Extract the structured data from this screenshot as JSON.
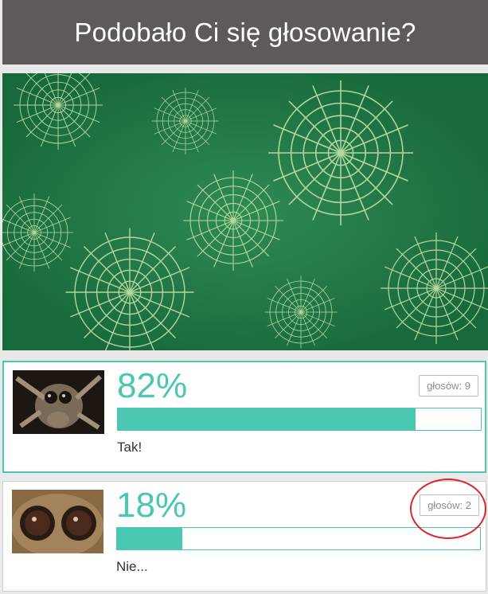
{
  "header": {
    "title": "Podobało Ci się głosowanie?"
  },
  "hero": {
    "icon": "spiderweb-image"
  },
  "options": [
    {
      "percent": "82%",
      "fill": 0.82,
      "votes": "głosów: 9",
      "label": "Tak!",
      "thumb": "spider-photo"
    },
    {
      "percent": "18%",
      "fill": 0.18,
      "votes": "głosów: 2",
      "label": "Nie...",
      "thumb": "spider-eyes-photo"
    }
  ],
  "colors": {
    "accent": "#49c7b0",
    "header_bg": "#5f5a58",
    "annotation": "#d6282c"
  }
}
